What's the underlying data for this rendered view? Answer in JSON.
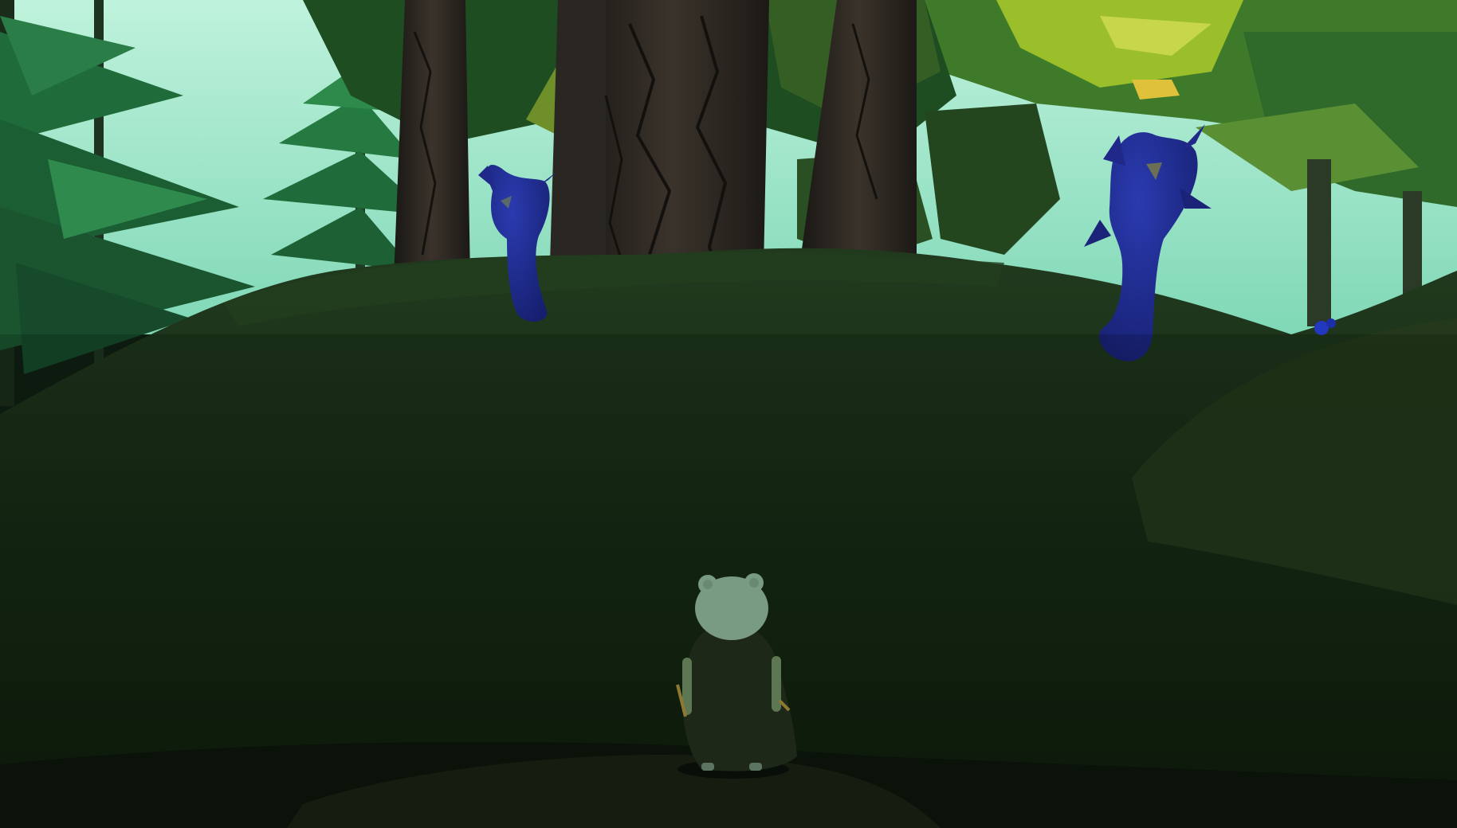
{
  "scene": {
    "colors": {
      "sky": "#8fe0c0",
      "sky_bright": "#bff2dc",
      "canopy_dark": "#1f4d22",
      "canopy_mid": "#3f7a2a",
      "canopy_light": "#9bbf2a",
      "foliage_yellow": "#c8d64a",
      "pine_green": "#1f6b3a",
      "trunk": "#2f2a24",
      "trunk_dark": "#1a1815",
      "ground": "#1c2e18",
      "ground_dark": "#101c0e",
      "ghost": "#1e2a8a",
      "ghost_light": "#2a3bb0",
      "player_body": "#24301e",
      "player_head": "#8fb59a"
    },
    "entities": [
      {
        "type": "ghost-creature",
        "name": "left-ghost"
      },
      {
        "type": "ghost-creature",
        "name": "right-ghost"
      },
      {
        "type": "player-character",
        "name": "player"
      }
    ]
  }
}
